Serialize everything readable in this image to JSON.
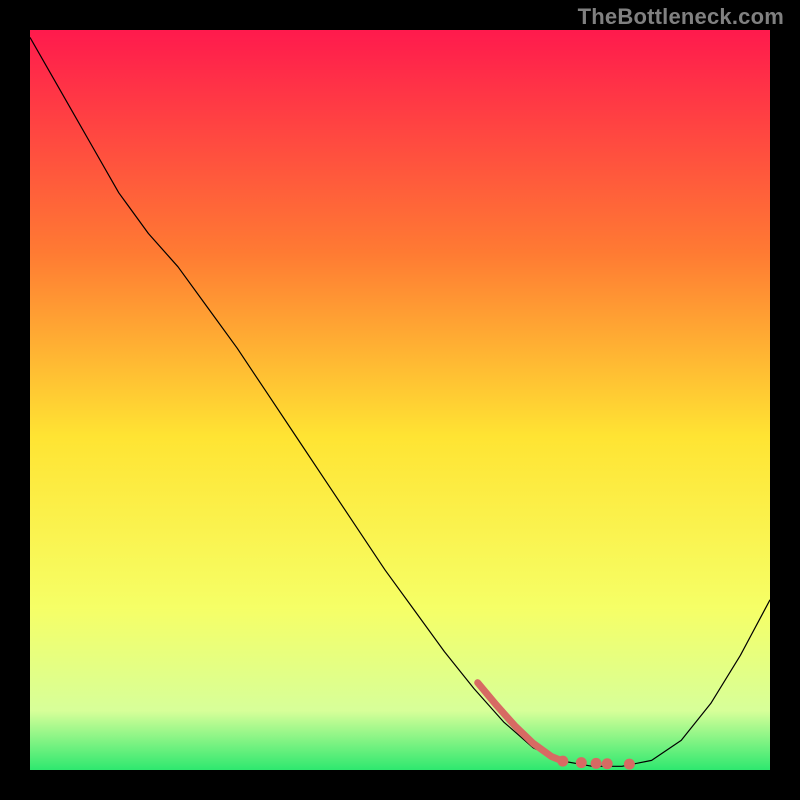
{
  "watermark": "TheBottleneck.com",
  "chart_data": {
    "type": "line",
    "title": "",
    "xlabel": "",
    "ylabel": "",
    "xlim": [
      0,
      100
    ],
    "ylim": [
      0,
      100
    ],
    "grid": false,
    "legend": false,
    "background_gradient": {
      "top": "#ff1a4d",
      "mid1": "#ff7a33",
      "mid2": "#ffe433",
      "mid3": "#f6ff66",
      "mid4": "#d7ff99",
      "bottom": "#2ee86f"
    },
    "series": [
      {
        "name": "curve",
        "color": "#000000",
        "stroke_width": 1.2,
        "x": [
          0,
          4,
          8,
          12,
          16,
          20,
          24,
          28,
          32,
          36,
          40,
          44,
          48,
          52,
          56,
          60,
          64,
          68,
          72,
          76,
          80,
          84,
          88,
          92,
          96,
          100
        ],
        "y": [
          99,
          92,
          85,
          78,
          72.5,
          68,
          62.5,
          57,
          51,
          45,
          39,
          33,
          27,
          21.5,
          16,
          11,
          6.5,
          3,
          1.2,
          0.5,
          0.5,
          1.3,
          4,
          9,
          15.5,
          23
        ]
      },
      {
        "name": "highlight-segment",
        "color": "#d76a63",
        "stroke_width": 7,
        "linecap": "round",
        "x": [
          60.5,
          63,
          65.5,
          68,
          70.5,
          72
        ],
        "y": [
          11.8,
          8.8,
          6.0,
          3.6,
          1.8,
          1.2
        ]
      },
      {
        "name": "highlight-dots",
        "color": "#d76a63",
        "radius": 5.5,
        "type": "scatter",
        "x": [
          72,
          74.5,
          76.5,
          78,
          81
        ],
        "y": [
          1.2,
          1.0,
          0.9,
          0.85,
          0.8
        ]
      }
    ]
  }
}
